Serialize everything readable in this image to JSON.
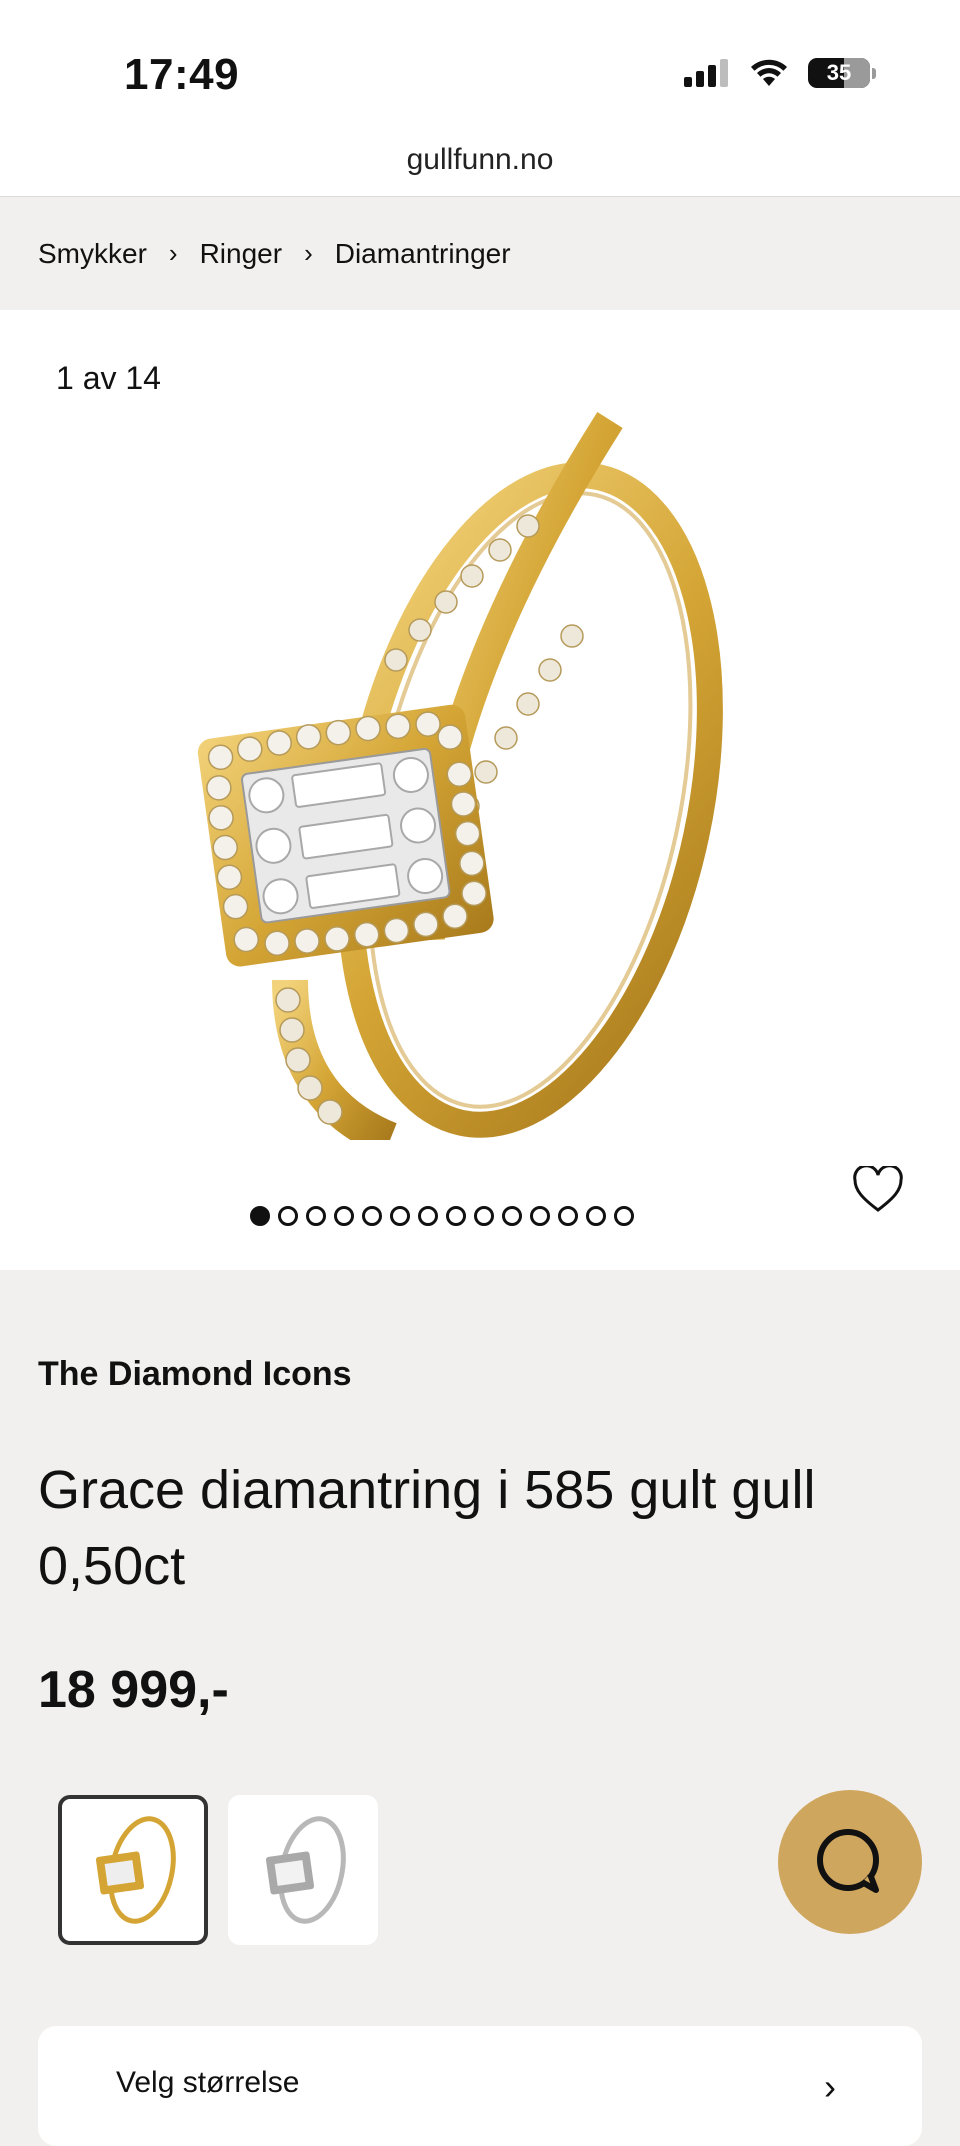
{
  "status_bar": {
    "time": "17:49",
    "battery": "35"
  },
  "browser": {
    "url": "gullfunn.no"
  },
  "breadcrumb": {
    "items": [
      "Smykker",
      "Ringer",
      "Diamantringer"
    ]
  },
  "gallery": {
    "counter": "1 av 14",
    "image_count": 14,
    "active_index": 0
  },
  "product": {
    "brand": "The Diamond Icons",
    "title": "Grace diamantring i 585 gult gull 0,50ct",
    "price": "18 999,-"
  },
  "variants": [
    {
      "name": "yellow-gold",
      "selected": true
    },
    {
      "name": "white-gold",
      "selected": false
    }
  ],
  "icons": {
    "favorite": "heart-icon",
    "chat": "chat-icon",
    "breadcrumb_separator": "chevron-right-icon"
  },
  "colors": {
    "accent_gold": "#cfa65e",
    "background": "#f1f0ee"
  },
  "bottom_card": {
    "label": "Velg størrelse"
  }
}
